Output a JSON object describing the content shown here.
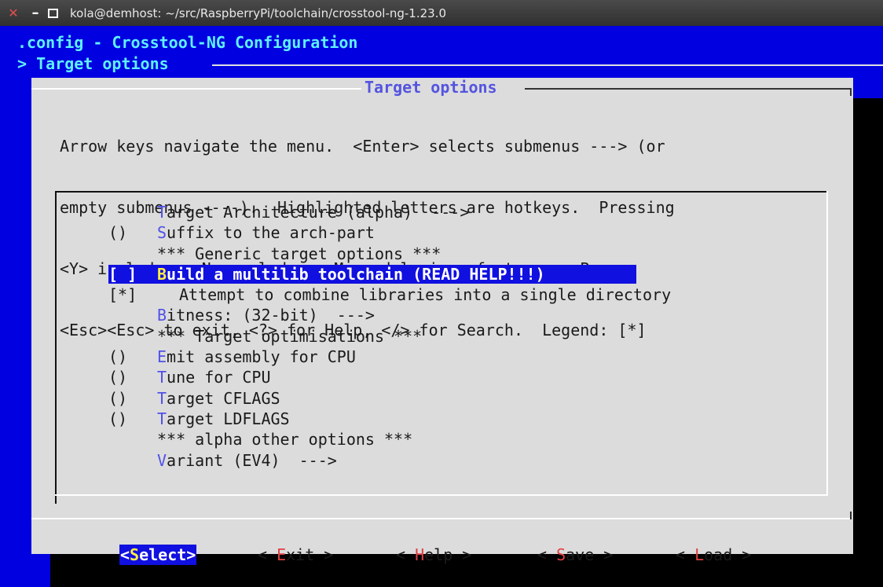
{
  "window": {
    "title": "kola@demhost: ~/src/RaspberryPi/toolchain/crosstool-ng-1.23.0"
  },
  "header": {
    "config_title": ".config - Crosstool-NG Configuration",
    "breadcrumb": "> Target options"
  },
  "dialog": {
    "title": "Target options",
    "help_lines": [
      "Arrow keys navigate the menu.  <Enter> selects submenus ---> (or",
      "empty submenus ----).  Highlighted letters are hotkeys.  Pressing",
      "<Y> includes, <N> excludes, <M> modularizes features.  Press",
      "<Esc><Esc> to exit, <?> for Help, </> for Search.  Legend: [*]"
    ]
  },
  "menu": {
    "items": [
      {
        "mark": "",
        "hotkey": "T",
        "rest": "arget Architecture (alpha)  --->",
        "selected": false,
        "indent": false
      },
      {
        "mark": "()",
        "hotkey": "S",
        "rest": "uffix to the arch-part",
        "selected": false,
        "indent": false
      },
      {
        "mark": "",
        "hotkey": "",
        "rest": "*** Generic target options ***",
        "selected": false,
        "indent": false
      },
      {
        "mark": "[ ]",
        "hotkey": "B",
        "rest": "uild a multilib toolchain (READ HELP!!!)",
        "selected": true,
        "indent": false
      },
      {
        "mark": "[*]",
        "hotkey": "",
        "rest": "Attempt to combine libraries into a single directory",
        "selected": false,
        "indent": true
      },
      {
        "mark": "",
        "hotkey": "B",
        "rest": "itness: (32-bit)  --->",
        "selected": false,
        "indent": false
      },
      {
        "mark": "",
        "hotkey": "",
        "rest": "*** Target optimisations ***",
        "selected": false,
        "indent": false
      },
      {
        "mark": "()",
        "hotkey": "E",
        "rest": "mit assembly for CPU",
        "selected": false,
        "indent": false
      },
      {
        "mark": "()",
        "hotkey": "T",
        "rest": "une for CPU",
        "selected": false,
        "indent": false
      },
      {
        "mark": "()",
        "hotkey": "T",
        "rest": "arget CFLAGS",
        "selected": false,
        "indent": false
      },
      {
        "mark": "()",
        "hotkey": "T",
        "rest": "arget LDFLAGS",
        "selected": false,
        "indent": false
      },
      {
        "mark": "",
        "hotkey": "",
        "rest": "*** alpha other options ***",
        "selected": false,
        "indent": false
      },
      {
        "mark": "",
        "hotkey": "V",
        "rest": "ariant (EV4)  --->",
        "selected": false,
        "indent": false
      }
    ]
  },
  "buttons": [
    {
      "pre": "<",
      "key": "S",
      "post": "elect>",
      "active": true
    },
    {
      "pre": "< ",
      "key": "E",
      "post": "xit >",
      "active": false
    },
    {
      "pre": "< ",
      "key": "H",
      "post": "elp >",
      "active": false
    },
    {
      "pre": "< ",
      "key": "S",
      "post": "ave >",
      "active": false
    },
    {
      "pre": "< ",
      "key": "L",
      "post": "oad >",
      "active": false
    }
  ],
  "colors": {
    "terminal_bg": "#0000e0",
    "dialog_bg": "#dcdcdc",
    "highlight": "#1010e0",
    "hotkey_selected": "#ffee40",
    "hotkey": "#5050e8",
    "button_hotkey": "#e04040",
    "header_text": "#5ff0ff"
  }
}
